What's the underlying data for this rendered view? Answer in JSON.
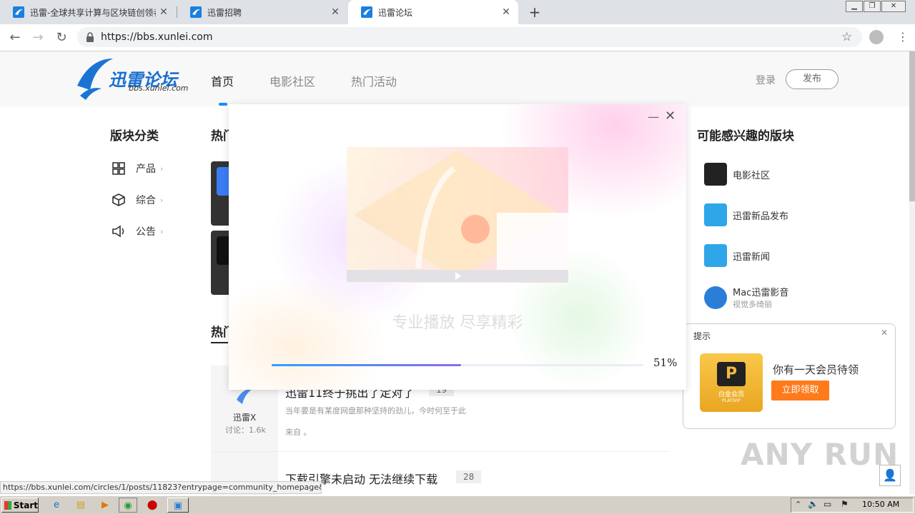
{
  "browser": {
    "tabs": [
      {
        "title": "迅雷-全球共享计算与区块链创领者",
        "active": false
      },
      {
        "title": "迅雷招聘",
        "active": false
      },
      {
        "title": "迅雷论坛",
        "active": true
      }
    ],
    "url": "https://bbs.xunlei.com",
    "status_url": "https://bbs.xunlei.com/circles/1/posts/11823?entrypage=community_homepage&entry=hot"
  },
  "site": {
    "logo_text": "迅雷论坛",
    "logo_sub": "bbs.xunlei.com",
    "nav": [
      "首页",
      "电影社区",
      "热门活动"
    ],
    "login": "登录",
    "publish": "发布"
  },
  "left": {
    "heading": "版块分类",
    "categories": [
      {
        "label": "产品",
        "icon": "grid-icon"
      },
      {
        "label": "综合",
        "icon": "cube-icon"
      },
      {
        "label": "公告",
        "icon": "megaphone-icon"
      }
    ]
  },
  "middle": {
    "heading_fragment": "热门",
    "heading_fragment2": "热门",
    "posts": [
      {
        "title": "迅雷11终于挑出了定对了",
        "count": "19",
        "desc": "当年要是有某度网盘那种坚持的劲儿，今时何至于此",
        "from": "来自 。",
        "circle": "迅雷X",
        "circle_meta": "讨论：1.6k"
      },
      {
        "title": "下载引擎未启动 无法继续下载",
        "count": "28"
      }
    ]
  },
  "right": {
    "heading": "可能感兴趣的版块",
    "boards": [
      {
        "name": "电影社区",
        "sub": "",
        "color": "#222222"
      },
      {
        "name": "迅雷新品发布",
        "sub": "",
        "color": "#2ea6e8"
      },
      {
        "name": "迅雷新闻",
        "sub": "",
        "color": "#2ea6e8"
      },
      {
        "name": "Mac迅雷影音",
        "sub": "视觉多绮丽",
        "color": "#2a7ed8"
      }
    ]
  },
  "notice": {
    "title": "提示",
    "text": "你有一天会员待领",
    "button": "立即领取",
    "card_label": "白金会员",
    "card_sub": "PLATIVIP"
  },
  "popup": {
    "tagline": "专业播放 尽享精彩",
    "progress": 0.51,
    "progress_text": "51%"
  },
  "watermark": "ANY RUN",
  "taskbar": {
    "start": "Start",
    "clock": "10:50 AM"
  }
}
